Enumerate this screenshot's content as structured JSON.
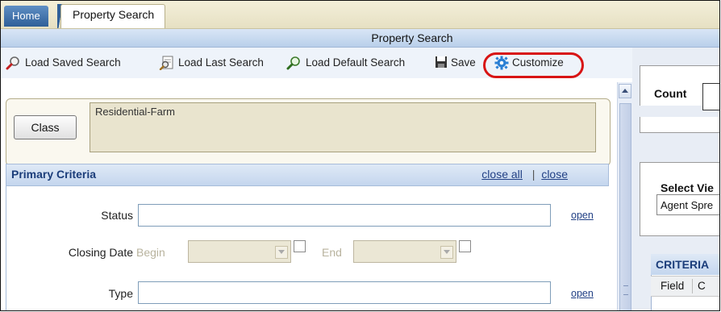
{
  "tabs": {
    "home": "Home",
    "active": "Property Search"
  },
  "window_title": "Property Search",
  "toolbar": {
    "load_saved": "Load Saved Search",
    "load_last": "Load Last Search",
    "load_default": "Load Default Search",
    "save": "Save",
    "customize": "Customize"
  },
  "class": {
    "button": "Class",
    "value": "Residential-Farm"
  },
  "primary_criteria": {
    "title": "Primary Criteria",
    "close_all": "close all",
    "separator": "|",
    "close": "close"
  },
  "fields": {
    "status": {
      "label": "Status",
      "value": "",
      "open": "open"
    },
    "closing_date": {
      "label": "Closing Date",
      "begin": "Begin",
      "end": "End"
    },
    "type": {
      "label": "Type",
      "value": "",
      "open": "open"
    }
  },
  "right": {
    "count_label": "Count",
    "select_view_label": "Select Vie",
    "select_view_value": "Agent Spre",
    "criteria_header": "CRITERIA",
    "col_field": "Field",
    "col_c": "C"
  },
  "colors": {
    "highlight_circle": "#d81414",
    "link": "#203f84",
    "header_text": "#1b3d7a"
  }
}
